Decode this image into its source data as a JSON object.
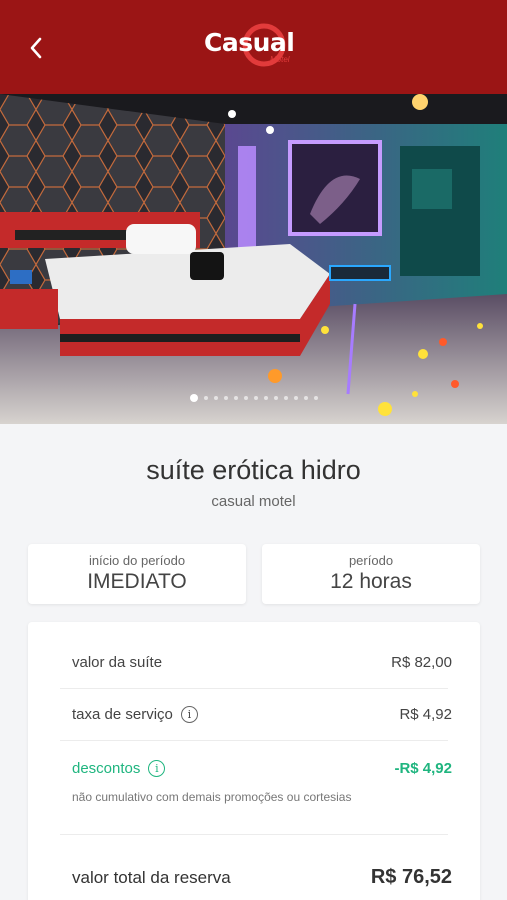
{
  "header": {
    "brand_name": "Casual",
    "brand_sub": "Motel",
    "back_icon": "chevron-left-icon",
    "bg_color": "#9b1515"
  },
  "gallery": {
    "image_count": 13,
    "active_index": 0
  },
  "suite": {
    "name": "suíte erótica hidro",
    "motel": "casual motel"
  },
  "period": {
    "start_label": "início do período",
    "start_value": "IMEDIATO",
    "duration_label": "período",
    "duration_value": "12 horas"
  },
  "summary": {
    "suite_value_label": "valor da suíte",
    "suite_value": "R$ 82,00",
    "service_fee_label": "taxa de serviço",
    "service_fee": "R$ 4,92",
    "discounts_label": "descontos",
    "discounts": "-R$ 4,92",
    "discount_note": "não cumulativo com demais promoções ou cortesias",
    "total_label": "valor total da reserva",
    "total": "R$ 76,52",
    "accent_green": "#1fb57f"
  }
}
